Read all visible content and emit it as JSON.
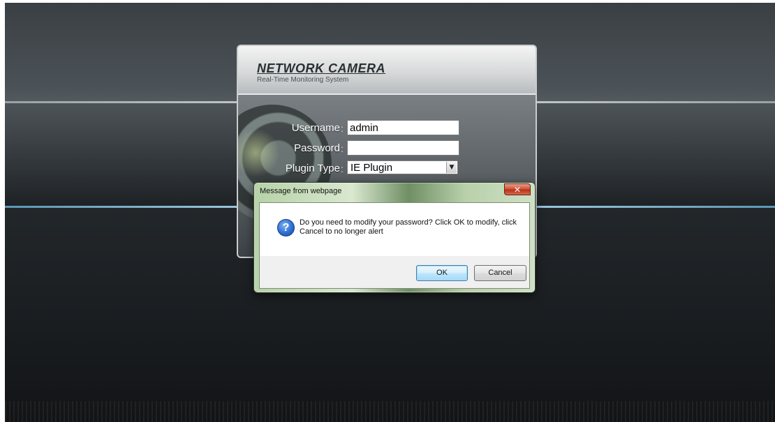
{
  "brand": {
    "title": "NETWORK CAMERA",
    "subtitle": "Real-Time Monitoring System"
  },
  "login_form": {
    "username_label": "Username",
    "username_value": "admin",
    "password_label": "Password",
    "password_value": "",
    "plugin_label": "Plugin Type",
    "plugin_value": "IE Plugin",
    "separator": ":"
  },
  "dialog": {
    "title": "Message from webpage",
    "close_glyph": "✕",
    "icon": "question-icon",
    "icon_glyph": "?",
    "message": "Do you need to modify your password? Click OK to modify, click Cancel to no longer alert",
    "ok_label": "OK",
    "cancel_label": "Cancel"
  },
  "icons": {
    "dropdown_arrow": "▼"
  }
}
